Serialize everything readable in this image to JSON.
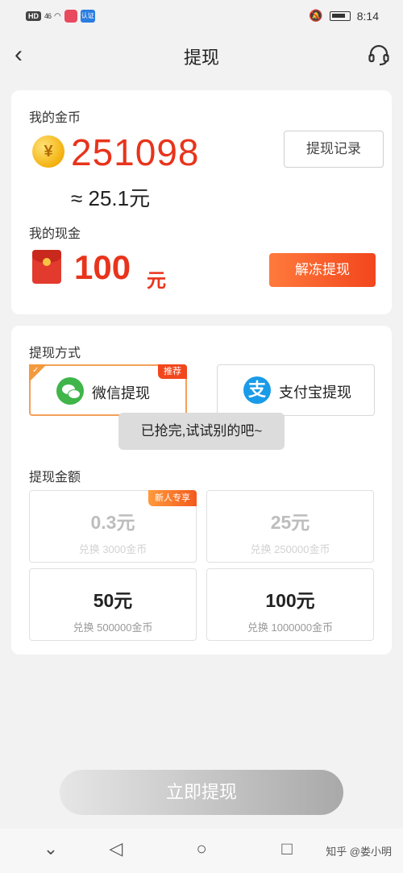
{
  "status_bar": {
    "hd": "HD",
    "signal": "46",
    "app_badge": "认证",
    "time": "8:14"
  },
  "header": {
    "title": "提现"
  },
  "balance": {
    "coins_label": "我的金币",
    "coins_value": "251098",
    "coins_approx": "≈ 25.1元",
    "coin_symbol": "¥",
    "record_button": "提现记录",
    "cash_label": "我的现金",
    "cash_value": "100",
    "cash_unit": "元",
    "unfreeze_button": "解冻提现"
  },
  "withdraw": {
    "method_label": "提现方式",
    "methods": [
      {
        "label": "微信提现",
        "badge": "推荐",
        "selected": true
      },
      {
        "label": "支付宝提现",
        "selected": false
      }
    ],
    "toast": "已抢完,试试别的吧~",
    "amount_label": "提现金额",
    "amounts": [
      {
        "value": "0.3元",
        "exchange": "兑换 3000金币",
        "badge": "新人专享",
        "disabled": true
      },
      {
        "value": "25元",
        "exchange": "兑换 250000金币",
        "disabled": true
      },
      {
        "value": "50元",
        "exchange": "兑换 500000金币",
        "disabled": false
      },
      {
        "value": "100元",
        "exchange": "兑换 1000000金币",
        "disabled": false
      }
    ]
  },
  "footer": {
    "withdraw_button": "立即提现",
    "watermark": "知乎 @娄小明"
  },
  "colors": {
    "accent_red": "#e8341c",
    "accent_orange": "#f2461d",
    "wechat_green": "#3fb54a",
    "alipay_blue": "#1a9be8"
  }
}
